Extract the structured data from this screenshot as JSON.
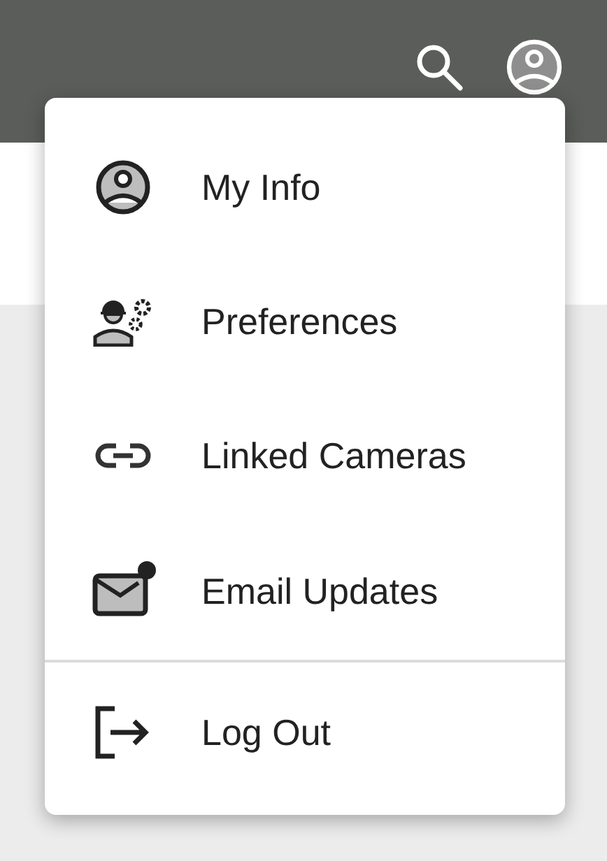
{
  "account_menu": {
    "items": [
      {
        "label": "My Info",
        "notification": false
      },
      {
        "label": "Preferences",
        "notification": false
      },
      {
        "label": "Linked Cameras",
        "notification": false
      },
      {
        "label": "Email Updates",
        "notification": true
      }
    ],
    "footer_item": {
      "label": "Log Out"
    }
  }
}
